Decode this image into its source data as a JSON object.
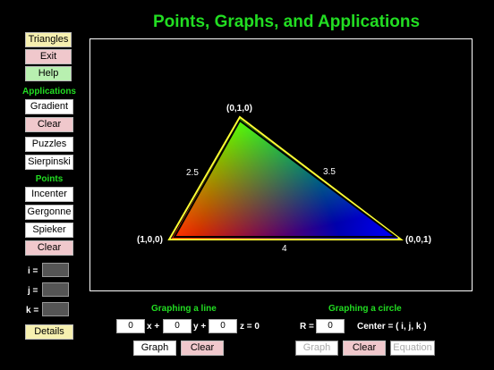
{
  "title": "Points, Graphs, and Applications",
  "sidebar": {
    "triangles": "Triangles",
    "exit": "Exit",
    "help": "Help",
    "applications_label": "Applications",
    "gradient": "Gradient",
    "clear_app": "Clear",
    "puzzles": "Puzzles",
    "sierpinski": "Sierpinski",
    "points_label": "Points",
    "incenter": "Incenter",
    "gergonne": "Gergonne",
    "spieker": "Spieker",
    "clear_points": "Clear",
    "i_label": "i =",
    "j_label": "j =",
    "k_label": "k =",
    "details": "Details"
  },
  "triangle": {
    "top_vertex": "(0,1,0)",
    "left_vertex": "(1,0,0)",
    "right_vertex": "(0,0,1)",
    "left_side": "2.5",
    "right_side": "3.5",
    "bottom_side": "4"
  },
  "line_graph": {
    "heading": "Graphing a line",
    "a": "0",
    "x_plus": "x +",
    "b": "0",
    "y_plus": "y +",
    "c": "0",
    "z_eq": "z = 0",
    "graph": "Graph",
    "clear": "Clear"
  },
  "circle_graph": {
    "heading": "Graphing a circle",
    "r_label": "R =",
    "r": "0",
    "center": "Center = ( i, j, k )",
    "graph": "Graph",
    "clear": "Clear",
    "equation": "Equation"
  },
  "colors": {
    "accent_green": "#22dd22",
    "triangle_outline": "#ffff33"
  }
}
